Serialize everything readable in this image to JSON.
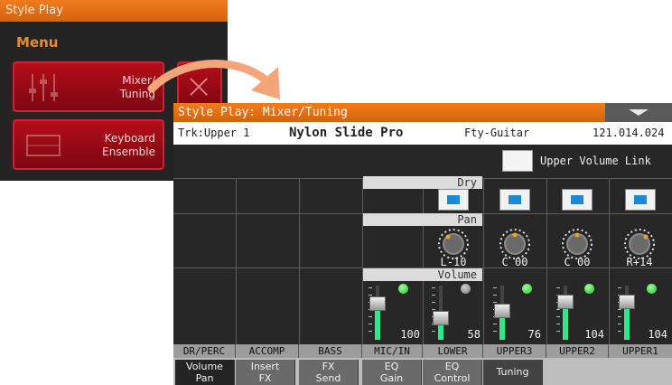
{
  "menu_panel": {
    "title": "Style Play",
    "menu_label": "Menu",
    "buttons": [
      {
        "line1": "Mixer/",
        "line2": "Tuning"
      },
      {
        "line1": "Keyboard",
        "line2": "Ensemble"
      }
    ]
  },
  "screen": {
    "title": "Style Play: Mixer/Tuning",
    "track": "Trk:Upper 1",
    "sound_name": "Nylon Slide Pro",
    "category": "Fty-Guitar",
    "program": "121.014.024",
    "upper_volume_link_label": "Upper Volume Link",
    "sections": {
      "dry": "Dry",
      "pan": "Pan",
      "volume": "Volume"
    },
    "channels": [
      {
        "name": "DR/PERC"
      },
      {
        "name": "ACCOMP"
      },
      {
        "name": "BASS"
      },
      {
        "name": "MIC/IN"
      },
      {
        "name": "LOWER",
        "pan": "L-10",
        "volume": "58",
        "led": "off"
      },
      {
        "name": "UPPER3",
        "pan": "C 00",
        "volume": "76",
        "led": "on"
      },
      {
        "name": "UPPER2",
        "pan": "C 00",
        "volume": "104",
        "led": "on"
      },
      {
        "name": "UPPER1",
        "pan": "R+14",
        "volume": "104",
        "led": "on"
      }
    ],
    "mic_volume": "100",
    "tabs": [
      {
        "line1": "Volume",
        "line2": "Pan"
      },
      {
        "line1": "Insert",
        "line2": "FX"
      },
      {
        "line1": "FX",
        "line2": "Send"
      },
      {
        "line1": "EQ",
        "line2": "Gain"
      },
      {
        "line1": "EQ",
        "line2": "Control"
      },
      {
        "label": "Tuning"
      }
    ],
    "colors": {
      "accent": "#e8701a",
      "led_on": "#22c022",
      "fader_fill": "#2fe88a",
      "dry_indicator": "#1b8bd8"
    }
  }
}
